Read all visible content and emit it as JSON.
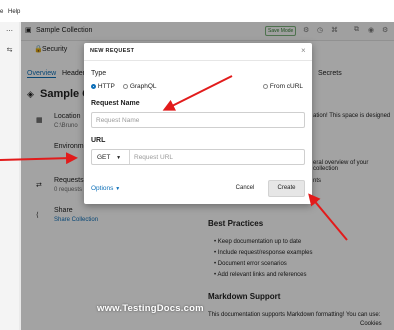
{
  "menubar": {
    "menu1": "Help",
    "menu0": "e"
  },
  "sidebar": {
    "icons": [
      "more-icon",
      "compare-icon"
    ]
  },
  "collection": {
    "tab_title": "Sample Collection",
    "save_mode": "Save Mode",
    "breadcrumb": "Security",
    "tabs": [
      "Overview",
      "Headers",
      "Secrets"
    ],
    "heading": "Sample Co",
    "sections": [
      {
        "label": "Location",
        "value": "C:\\Bruno"
      },
      {
        "label": "Environments",
        "value": ""
      },
      {
        "label": "Requests",
        "value": "0 requests"
      },
      {
        "label": "Share",
        "value": "Share Collection"
      }
    ],
    "right_text": {
      "line1": "ation! This space is designed",
      "line2": "eral overview of your collection",
      "line3": "nts",
      "best_practices_title": "Best Practices",
      "best_practices": [
        "Keep documentation up to date",
        "Include request/response examples",
        "Document error scenarios",
        "Add relevant links and references"
      ],
      "markdown_title": "Markdown Support",
      "markdown_line": "This documentation supports Markdown formatting! You can use:",
      "footer": "Cookies"
    }
  },
  "modal": {
    "title": "NEW REQUEST",
    "type_label": "Type",
    "types": [
      "HTTP",
      "GraphQL"
    ],
    "selected_type": "HTTP",
    "from_curl": "From cURL",
    "request_name_label": "Request Name",
    "request_name_placeholder": "Request Name",
    "url_label": "URL",
    "method": "GET",
    "url_placeholder": "Request URL",
    "options_label": "Options",
    "cancel_label": "Cancel",
    "create_label": "Create"
  },
  "watermark": "www.TestingDocs.com",
  "colors": {
    "accent": "#0d6fb8",
    "arrow": "#e21b1b",
    "watermark": "#ffffff"
  }
}
